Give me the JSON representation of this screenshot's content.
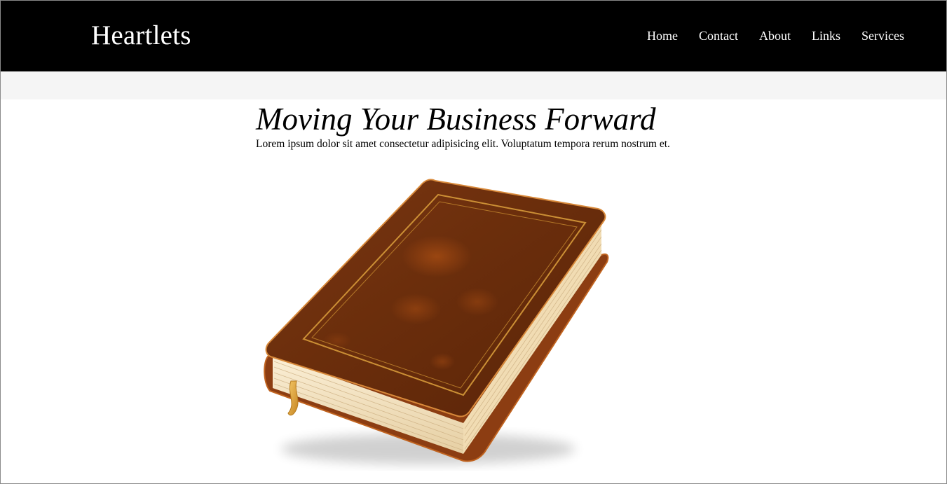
{
  "header": {
    "brand": "Heartlets",
    "nav": [
      {
        "label": "Home"
      },
      {
        "label": "Contact"
      },
      {
        "label": "About"
      },
      {
        "label": "Links"
      },
      {
        "label": "Services"
      }
    ]
  },
  "hero": {
    "title": "Moving Your Business Forward",
    "text": "Lorem ipsum dolor sit amet consectetur adipisicing elit. Voluptatum tempora rerum nostrum et."
  },
  "colors": {
    "navbar": "#000000",
    "band": "#f5f5f5",
    "book_cover": "#6b2e0c",
    "book_pages": "#f3e2c2",
    "gold": "#e2a93a"
  }
}
